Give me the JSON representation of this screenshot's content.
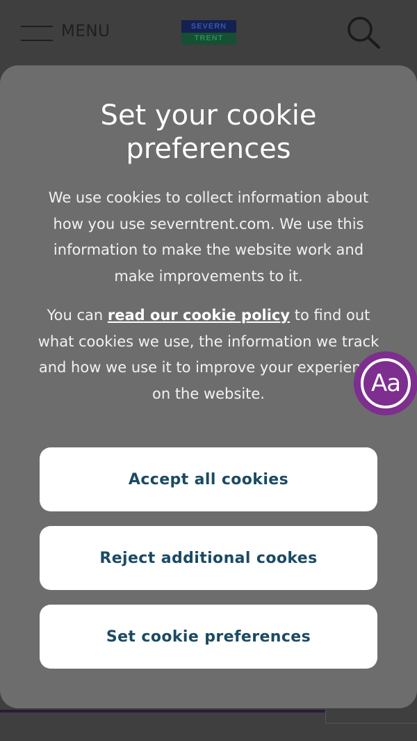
{
  "header": {
    "menu_label": "MENU",
    "logo": {
      "top_text": "SEVERN",
      "bottom_text": "TRENT",
      "top_color": "#12214f",
      "bottom_color": "#164f33"
    }
  },
  "cookie_modal": {
    "title": "Set your cookie preferences",
    "intro": "We use cookies to collect information about how you use severntrent.com. We use this information to make the website work and make improvements to it.",
    "policy_prefix": "You can ",
    "policy_link": "read our cookie policy",
    "policy_suffix": " to find out what cookies we use, the information we track and how we use it to improve your experience on the website.",
    "buttons": {
      "accept": "Accept all cookies",
      "reject": "Reject additional cookes",
      "preferences": "Set cookie preferences"
    }
  },
  "accessibility_badge": {
    "label": "Aa",
    "color": "#7d2e8f"
  },
  "colors": {
    "background": "#3f3f3f",
    "modal": "#6d6d6d",
    "button_text": "#1b4a63",
    "button_bg": "#ffffff"
  }
}
